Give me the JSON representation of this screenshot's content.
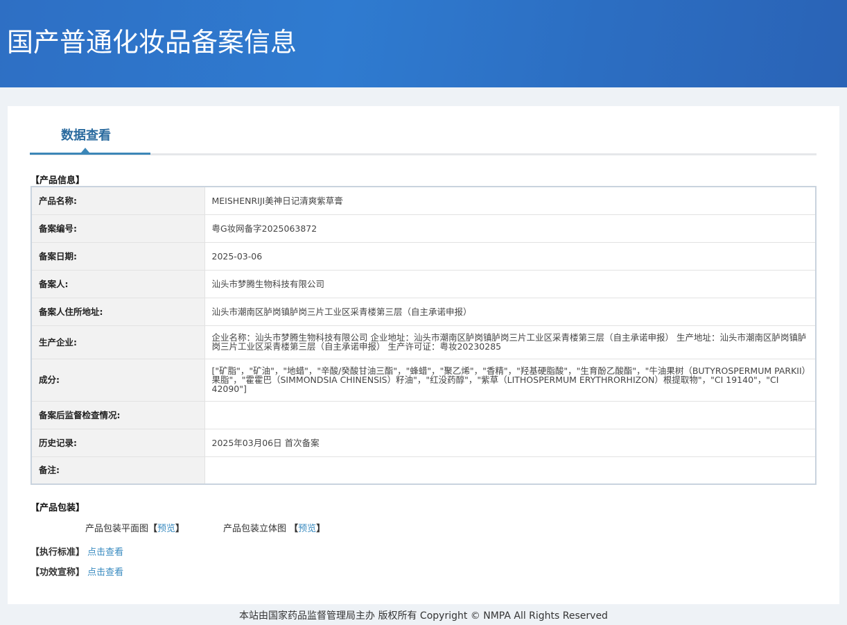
{
  "header": {
    "title": "国产普通化妆品备案信息"
  },
  "tab": {
    "label": "数据查看"
  },
  "product_info": {
    "section_title": "【产品信息】",
    "rows": [
      {
        "label": "产品名称:",
        "value": "MEISHENRIJI美神日记清爽紫草膏"
      },
      {
        "label": "备案编号:",
        "value": "粤G妆网备字2025063872"
      },
      {
        "label": "备案日期:",
        "value": "2025-03-06"
      },
      {
        "label": "备案人:",
        "value": "汕头市梦腾生物科技有限公司"
      },
      {
        "label": "备案人住所地址:",
        "value": "汕头市潮南区胪岗镇胪岗三片工业区采青楼第三层（自主承诺申报）"
      },
      {
        "label": "生产企业:",
        "value": "企业名称：汕头市梦腾生物科技有限公司 企业地址：汕头市潮南区胪岗镇胪岗三片工业区采青楼第三层（自主承诺申报） 生产地址：汕头市潮南区胪岗镇胪岗三片工业区采青楼第三层（自主承诺申报） 生产许可证：粤妆20230285"
      },
      {
        "label": "成分:",
        "value": "[\"矿脂\"，\"矿油\"，\"地蜡\"，\"辛酸/癸酸甘油三酯\"，\"蜂蜡\"，\"聚乙烯\"，\"香精\"，\"羟基硬脂酸\"，\"生育酚乙酸酯\"，\"牛油果树（BUTYROSPERMUM PARKII）果脂\"，\"霍霍巴（SIMMONDSIA CHINENSIS）籽油\"，\"红没药醇\"，\"紫草（LITHOSPERMUM ERYTHRORHIZON）根提取物\"，\"CI 19140\"，\"CI 42090\"]"
      },
      {
        "label": "备案后监督检查情况:",
        "value": ""
      },
      {
        "label": "历史记录:",
        "value": "2025年03月06日 首次备案"
      },
      {
        "label": "备注:",
        "value": ""
      }
    ]
  },
  "packaging": {
    "section_title": "【产品包装】",
    "flat_label": "产品包装平面图",
    "flat_link": "预览",
    "solid_label": "产品包装立体图",
    "solid_link": "预览",
    "bracket_open": "【",
    "bracket_close": "】"
  },
  "standard": {
    "section_title": "【执行标准】",
    "link": "点击查看"
  },
  "efficacy": {
    "section_title": "【功效宣称】",
    "link": "点击查看"
  },
  "footer": {
    "text": "本站由国家药品监督管理局主办 版权所有 Copyright © NMPA All Rights Reserved"
  }
}
